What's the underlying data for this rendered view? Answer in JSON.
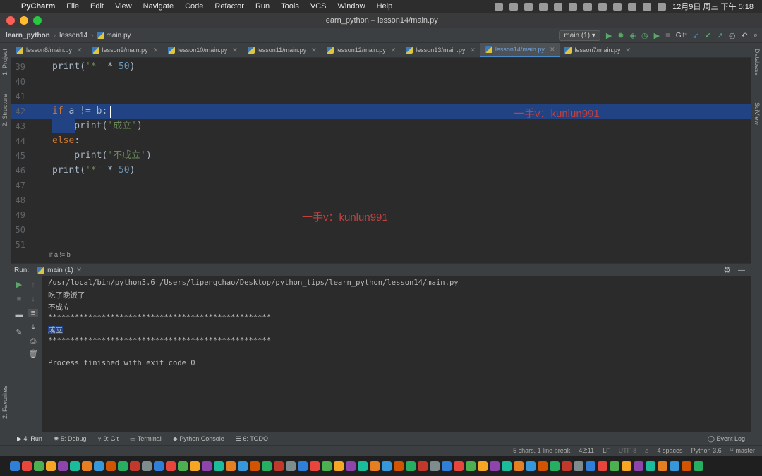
{
  "menubar": {
    "app": "PyCharm",
    "items": [
      "File",
      "Edit",
      "View",
      "Navigate",
      "Code",
      "Refactor",
      "Run",
      "Tools",
      "VCS",
      "Window",
      "Help"
    ],
    "clock": "12月9日 周三 下午 5:18"
  },
  "window": {
    "title": "learn_python – lesson14/main.py"
  },
  "navbar": {
    "crumbs": [
      "learn_python",
      "lesson14",
      "main.py"
    ],
    "run_config": "main (1)",
    "git_label": "Git:"
  },
  "left_tools": [
    "1: Project",
    "2: Structure",
    "2: Favorites"
  ],
  "right_tools": [
    "Database",
    "SciView"
  ],
  "tabs": [
    {
      "label": "lesson8/main.py",
      "active": false
    },
    {
      "label": "lesson9/main.py",
      "active": false
    },
    {
      "label": "lesson10/main.py",
      "active": false
    },
    {
      "label": "lesson11/main.py",
      "active": false
    },
    {
      "label": "lesson12/main.py",
      "active": false
    },
    {
      "label": "lesson13/main.py",
      "active": false
    },
    {
      "label": "lesson14/main.py",
      "active": true
    },
    {
      "label": "lesson7/main.py",
      "active": false
    }
  ],
  "editor": {
    "lines": [
      {
        "n": "39",
        "tokens": [
          {
            "t": "print(",
            "c": ""
          },
          {
            "t": "'*'",
            "c": "str"
          },
          {
            "t": " * ",
            "c": ""
          },
          {
            "t": "50",
            "c": "num"
          },
          {
            "t": ")",
            "c": ""
          }
        ]
      },
      {
        "n": "40",
        "tokens": []
      },
      {
        "n": "41",
        "tokens": []
      },
      {
        "n": "42",
        "tokens": [
          {
            "t": "if",
            "c": "kw"
          },
          {
            "t": " a != b:",
            "c": ""
          }
        ]
      },
      {
        "n": "43",
        "tokens": [
          {
            "t": "    print(",
            "c": ""
          },
          {
            "t": "'成立'",
            "c": "str"
          },
          {
            "t": ")",
            "c": ""
          }
        ]
      },
      {
        "n": "44",
        "tokens": [
          {
            "t": "else",
            "c": "kw"
          },
          {
            "t": ":",
            "c": ""
          }
        ]
      },
      {
        "n": "45",
        "tokens": [
          {
            "t": "    print(",
            "c": ""
          },
          {
            "t": "'不成立'",
            "c": "str"
          },
          {
            "t": ")",
            "c": ""
          }
        ]
      },
      {
        "n": "46",
        "tokens": [
          {
            "t": "print(",
            "c": ""
          },
          {
            "t": "'*'",
            "c": "str"
          },
          {
            "t": " * ",
            "c": ""
          },
          {
            "t": "50",
            "c": "num"
          },
          {
            "t": ")",
            "c": ""
          }
        ]
      },
      {
        "n": "47",
        "tokens": []
      },
      {
        "n": "48",
        "tokens": []
      },
      {
        "n": "49",
        "tokens": []
      },
      {
        "n": "50",
        "tokens": []
      },
      {
        "n": "51",
        "tokens": []
      }
    ],
    "watermark": "一手v：kunlun991",
    "breadcrumb": "if a != b"
  },
  "run": {
    "label": "Run:",
    "tab": "main (1)",
    "output": [
      "/usr/local/bin/python3.6 /Users/lipengchao/Desktop/python_tips/learn_python/lesson14/main.py",
      "吃了晚饭了",
      "不成立",
      "**************************************************",
      "成立",
      "**************************************************",
      "",
      "Process finished with exit code 0"
    ]
  },
  "bottom_tabs": [
    "4: Run",
    "5: Debug",
    "9: Git",
    "Terminal",
    "Python Console",
    "6: TODO"
  ],
  "event_log": "Event Log",
  "status": [
    "5 chars, 1 line break",
    "42:11",
    "LF",
    "UTF-8",
    "4 spaces",
    "Python 3.6",
    "master"
  ],
  "colors": {
    "accent": "#4a88c7",
    "selection": "#214283",
    "keyword": "#cc7832",
    "string": "#6a8759",
    "number": "#6897bb"
  }
}
